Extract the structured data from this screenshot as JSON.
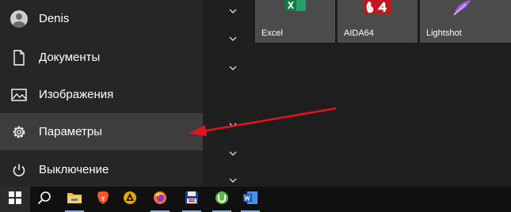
{
  "start_menu": {
    "items": [
      {
        "label": "Denis",
        "icon": "user-avatar-icon"
      },
      {
        "label": "Документы",
        "icon": "document-icon"
      },
      {
        "label": "Изображения",
        "icon": "image-icon"
      },
      {
        "label": "Параметры",
        "icon": "gear-icon",
        "highlighted": true
      },
      {
        "label": "Выключение",
        "icon": "power-icon"
      }
    ]
  },
  "tiles": [
    {
      "label": "Excel",
      "icon": "excel-icon",
      "color": "#1d6f42"
    },
    {
      "label": "AIDA64",
      "icon": "aida64-icon",
      "color": "#c4161c"
    },
    {
      "label": "Lightshot",
      "icon": "lightshot-feather-icon",
      "color": "#9b4fd6"
    }
  ],
  "annotation": {
    "color": "#e3131b"
  },
  "taskbar": {
    "items": [
      {
        "name": "windows-start-icon"
      },
      {
        "name": "search-icon"
      },
      {
        "name": "file-explorer-icon",
        "active": true
      },
      {
        "name": "brave-browser-icon",
        "active": false
      },
      {
        "name": "app-yellow-icon",
        "active": false
      },
      {
        "name": "firefox-icon",
        "active": true
      },
      {
        "name": "floppy-app-icon",
        "active": true
      },
      {
        "name": "utorrent-icon",
        "active": true
      },
      {
        "name": "word-icon",
        "active": true
      }
    ]
  }
}
